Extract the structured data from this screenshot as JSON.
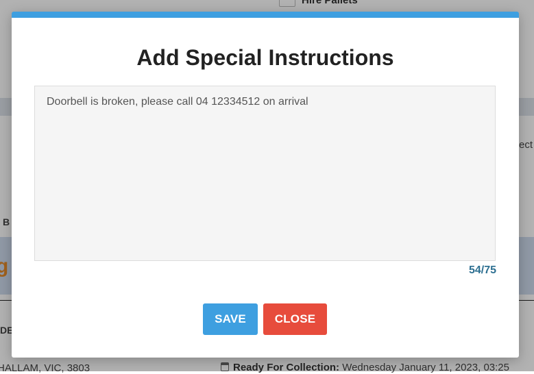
{
  "background": {
    "hire_pallets_label": "Hire Pallets",
    "select_label": "ect",
    "section_by_label": "B",
    "logo_text": "g",
    "section_de_label": "DE",
    "address_text": "HALLAM, VIC, 3803",
    "ready_label": "Ready For Collection:",
    "ready_value": "Wednesday January 11, 2023, 03:25"
  },
  "modal": {
    "title": "Add Special Instructions",
    "instructions_value": "Doorbell is broken, please call 04 12334512 on arrival",
    "char_counter": "54/75",
    "save_label": "SAVE",
    "close_label": "CLOSE"
  },
  "colors": {
    "accent": "#3e9fe0",
    "danger": "#e74c3c",
    "counter": "#2d6f91"
  }
}
